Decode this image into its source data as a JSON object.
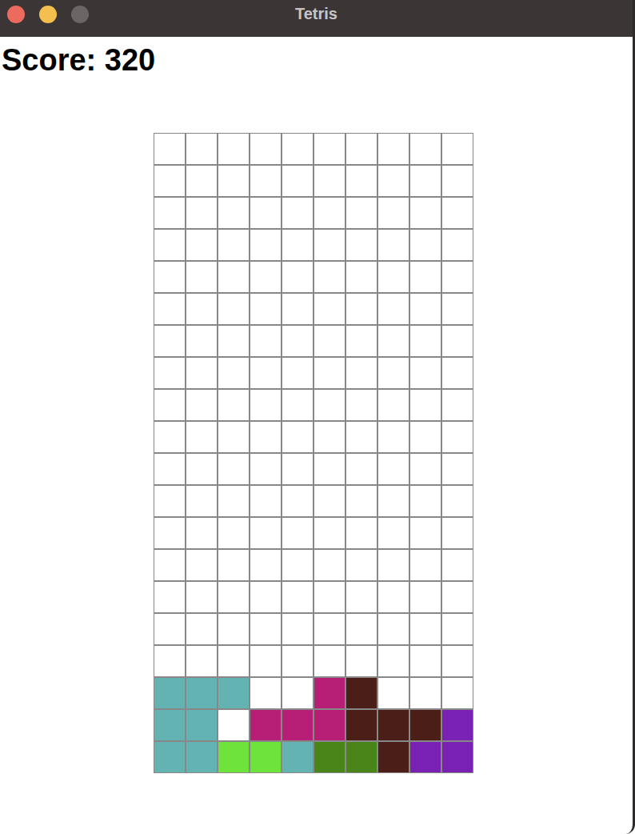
{
  "window": {
    "title": "Tetris",
    "zoom_enabled": false
  },
  "score": {
    "text": "Score: 320"
  },
  "board": {
    "rows": [
      [
        null,
        null,
        null,
        null,
        null,
        null,
        null,
        null,
        null,
        null
      ],
      [
        null,
        null,
        null,
        null,
        null,
        null,
        null,
        null,
        null,
        null
      ],
      [
        null,
        null,
        null,
        null,
        null,
        null,
        null,
        null,
        null,
        null
      ],
      [
        null,
        null,
        null,
        null,
        null,
        null,
        null,
        null,
        null,
        null
      ],
      [
        null,
        null,
        null,
        null,
        null,
        null,
        null,
        null,
        null,
        null
      ],
      [
        null,
        null,
        null,
        null,
        null,
        null,
        null,
        null,
        null,
        null
      ],
      [
        null,
        null,
        null,
        null,
        null,
        null,
        null,
        null,
        null,
        null
      ],
      [
        null,
        null,
        null,
        null,
        null,
        null,
        null,
        null,
        null,
        null
      ],
      [
        null,
        null,
        null,
        null,
        null,
        null,
        null,
        null,
        null,
        null
      ],
      [
        null,
        null,
        null,
        null,
        null,
        null,
        null,
        null,
        null,
        null
      ],
      [
        null,
        null,
        null,
        null,
        null,
        null,
        null,
        null,
        null,
        null
      ],
      [
        null,
        null,
        null,
        null,
        null,
        null,
        null,
        null,
        null,
        null
      ],
      [
        null,
        null,
        null,
        null,
        null,
        null,
        null,
        null,
        null,
        null
      ],
      [
        null,
        null,
        null,
        null,
        null,
        null,
        null,
        null,
        null,
        null
      ],
      [
        null,
        null,
        null,
        null,
        null,
        null,
        null,
        null,
        null,
        null
      ],
      [
        null,
        null,
        null,
        null,
        null,
        null,
        null,
        null,
        null,
        null
      ],
      [
        null,
        null,
        null,
        null,
        null,
        null,
        null,
        null,
        null,
        null
      ],
      [
        "#63b3b3",
        "#63b3b3",
        "#63b3b3",
        null,
        null,
        "#b71f76",
        "#4b1f17",
        null,
        null,
        null
      ],
      [
        "#63b3b3",
        "#63b3b3",
        null,
        "#b71f76",
        "#b71f76",
        "#b71f76",
        "#4b1f17",
        "#4b1f17",
        "#4b1f17",
        "#7a22b3"
      ],
      [
        "#63b3b3",
        "#63b3b3",
        "#6ee33c",
        "#6ee33c",
        "#63b3b3",
        "#4a8519",
        "#4a8519",
        "#4b1f17",
        "#7a22b3",
        "#7a22b3"
      ]
    ]
  }
}
